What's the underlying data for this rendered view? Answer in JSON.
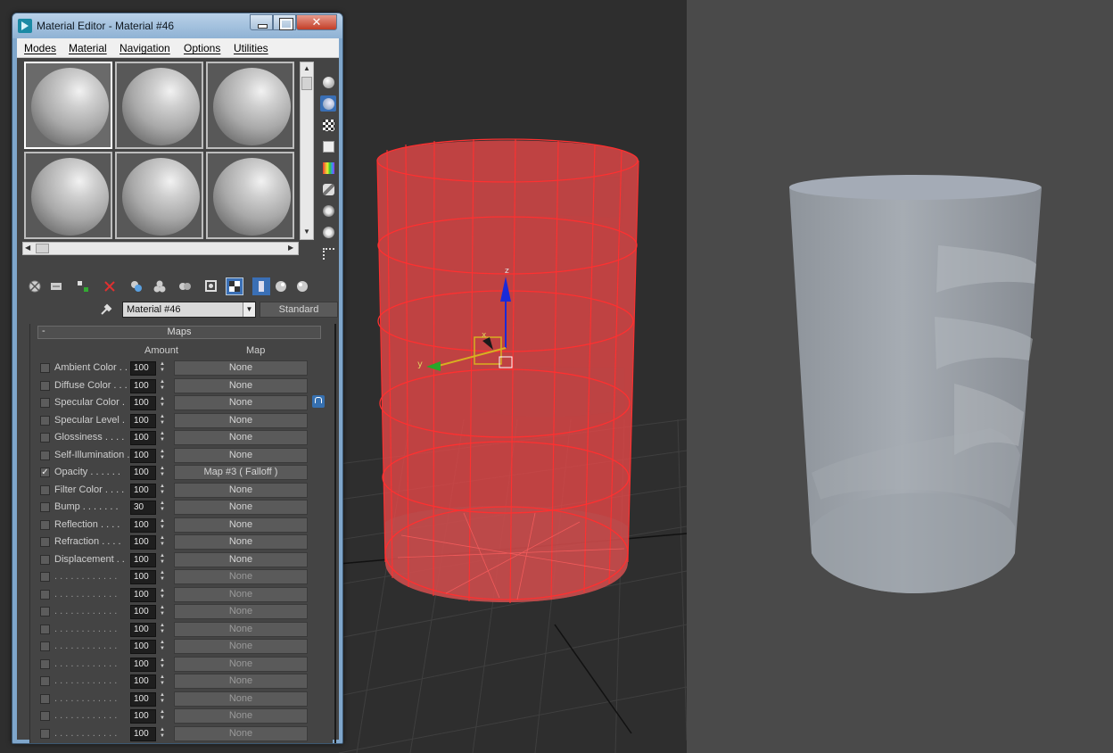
{
  "window": {
    "title": "Material Editor - Material #46",
    "close_glyph": "✕"
  },
  "menu": [
    {
      "label": "Modes"
    },
    {
      "label": "Material"
    },
    {
      "label": "Navigation"
    },
    {
      "label": "Options"
    },
    {
      "label": "Utilities"
    }
  ],
  "sample_slots": {
    "count": 6,
    "active_index": 0
  },
  "side_toolbar_icons": [
    "sample-type-icon",
    "backlight-icon",
    "background-checker-icon",
    "sample-uv-tiling-icon",
    "video-color-check-icon",
    "make-preview-icon",
    "options-icon",
    "select-by-material-icon",
    "material-map-navigator-icon"
  ],
  "bottom_toolbar_icons": [
    "get-material-icon",
    "put-to-scene-icon",
    "assign-to-selection-icon",
    "reset-map-icon",
    "copy-material-icon",
    "make-unique-icon",
    "put-to-library-icon",
    "material-id-channel-icon",
    "show-shaded-in-viewport-icon",
    "show-end-result-icon",
    "go-to-parent-icon",
    "go-forward-to-sibling-icon"
  ],
  "material": {
    "name": "Material #46",
    "type": "Standard"
  },
  "maps": {
    "title": "Maps",
    "collapse_glyph": "-",
    "col_amount": "Amount",
    "col_map": "Map",
    "rows": [
      {
        "checked": false,
        "label": "Ambient Color . .",
        "amount": "100",
        "map": "None"
      },
      {
        "checked": false,
        "label": "Diffuse Color . . .",
        "amount": "100",
        "map": "None"
      },
      {
        "checked": false,
        "label": "Specular Color  .",
        "amount": "100",
        "map": "None"
      },
      {
        "checked": false,
        "label": "Specular Level  .",
        "amount": "100",
        "map": "None"
      },
      {
        "checked": false,
        "label": "Glossiness  . . . .",
        "amount": "100",
        "map": "None"
      },
      {
        "checked": false,
        "label": "Self-Illumination .",
        "amount": "100",
        "map": "None"
      },
      {
        "checked": true,
        "label": "Opacity . . . . . .",
        "amount": "100",
        "map": "Map #3  ( Falloff )"
      },
      {
        "checked": false,
        "label": "Filter Color  . . . .",
        "amount": "100",
        "map": "None"
      },
      {
        "checked": false,
        "label": "Bump  . . . . . . .",
        "amount": "30",
        "map": "None"
      },
      {
        "checked": false,
        "label": "Reflection  . . . .",
        "amount": "100",
        "map": "None"
      },
      {
        "checked": false,
        "label": "Refraction  . . . .",
        "amount": "100",
        "map": "None"
      },
      {
        "checked": false,
        "label": "Displacement  . .",
        "amount": "100",
        "map": "None"
      },
      {
        "checked": false,
        "label": ". . . . . . . . . . . .",
        "amount": "100",
        "map": "None"
      },
      {
        "checked": false,
        "label": ". . . . . . . . . . . .",
        "amount": "100",
        "map": "None"
      },
      {
        "checked": false,
        "label": ". . . . . . . . . . . .",
        "amount": "100",
        "map": "None"
      },
      {
        "checked": false,
        "label": ". . . . . . . . . . . .",
        "amount": "100",
        "map": "None"
      },
      {
        "checked": false,
        "label": ". . . . . . . . . . . .",
        "amount": "100",
        "map": "None"
      },
      {
        "checked": false,
        "label": ". . . . . . . . . . . .",
        "amount": "100",
        "map": "None"
      },
      {
        "checked": false,
        "label": ". . . . . . . . . . . .",
        "amount": "100",
        "map": "None"
      },
      {
        "checked": false,
        "label": ". . . . . . . . . . . .",
        "amount": "100",
        "map": "None"
      },
      {
        "checked": false,
        "label": ". . . . . . . . . . . .",
        "amount": "100",
        "map": "None"
      },
      {
        "checked": false,
        "label": ". . . . . . . . . . . .",
        "amount": "100",
        "map": "None"
      },
      {
        "checked": false,
        "label": ". . . . . . . . . . . .",
        "amount": "100",
        "map": "None"
      }
    ]
  },
  "viewport_left": {
    "gizmo_axis_z": "z",
    "gizmo_axis_y": "y",
    "gizmo_axis_x": "x",
    "colors": {
      "cylinder_wire": "#ff3030",
      "cylinder_fill": "#e84848",
      "gizmo_z": "#1a2ad8",
      "gizmo_y": "#2aa52a",
      "gizmo_x": "#d8b020"
    }
  },
  "viewport_right": {
    "colors": {
      "background": "#4a4a4a",
      "cylinder": "#9aa0a8"
    }
  }
}
